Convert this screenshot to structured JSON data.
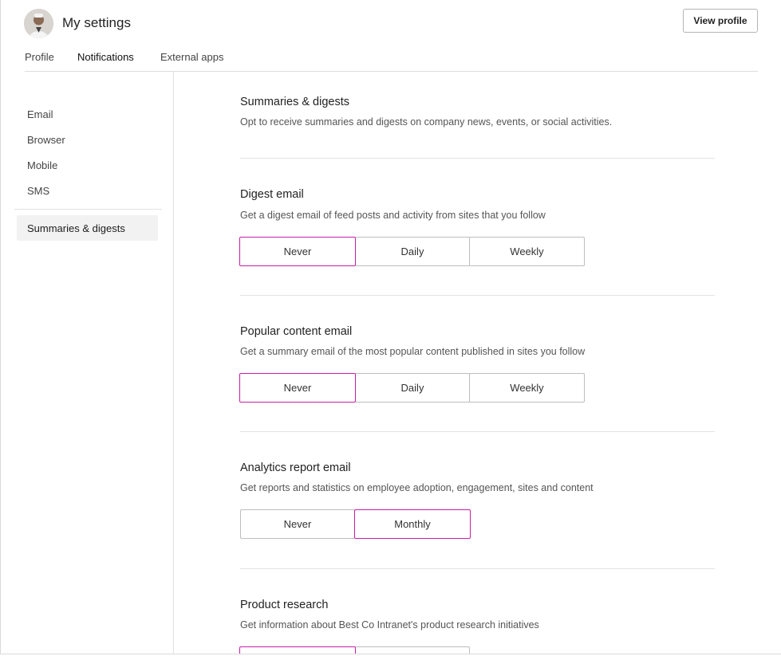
{
  "header": {
    "title": "My settings",
    "view_profile_label": "View profile",
    "avatar": "avatar-photo"
  },
  "tabs": [
    {
      "label": "Profile",
      "active": false
    },
    {
      "label": "Notifications",
      "active": true
    },
    {
      "label": "External apps",
      "active": false
    }
  ],
  "sidebar": {
    "items": [
      {
        "label": "Email"
      },
      {
        "label": "Browser"
      },
      {
        "label": "Mobile"
      },
      {
        "label": "SMS"
      }
    ],
    "active_item": {
      "label": "Summaries & digests"
    }
  },
  "main": {
    "intro": {
      "title": "Summaries & digests",
      "description": "Opt to receive summaries and digests on company news, events, or social activities."
    },
    "sections": [
      {
        "title": "Digest email",
        "description": "Get a digest email of feed posts and activity from sites that you follow",
        "options": [
          "Never",
          "Daily",
          "Weekly"
        ],
        "selected": "Never"
      },
      {
        "title": "Popular content email",
        "description": "Get a summary email of the most popular content published in sites you follow",
        "options": [
          "Never",
          "Daily",
          "Weekly"
        ],
        "selected": "Never"
      },
      {
        "title": "Analytics report email",
        "description": "Get reports and statistics on employee adoption, engagement, sites and content",
        "options": [
          "Never",
          "Monthly"
        ],
        "selected": "Monthly"
      },
      {
        "title": "Product research",
        "description": "Get information about Best Co Intranet's product research initiatives",
        "options": [
          "",
          ""
        ],
        "selected": ""
      }
    ]
  },
  "colors": {
    "accent": "#c81ea8",
    "border": "#bdbdbd",
    "text": "#323232"
  }
}
